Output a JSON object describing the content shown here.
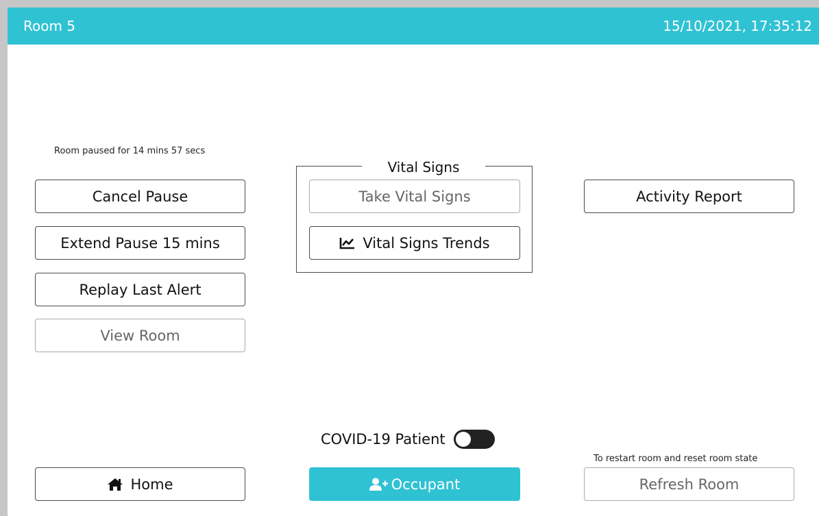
{
  "header": {
    "room_name": "Room 5",
    "datetime": "15/10/2021, 17:35:12",
    "background_color": "#2fc2d3"
  },
  "pause": {
    "status_text": "Room paused for 14 mins 57 secs",
    "cancel_label": "Cancel Pause",
    "extend_label": "Extend Pause 15 mins",
    "replay_label": "Replay Last Alert",
    "view_room_label": "View Room"
  },
  "vital_signs": {
    "legend": "Vital Signs",
    "take_label": "Take Vital Signs",
    "trends_label": "Vital Signs Trends",
    "trends_icon": "chart-line-icon"
  },
  "activity": {
    "report_label": "Activity Report"
  },
  "covid": {
    "label": "COVID-19 Patient",
    "enabled": false
  },
  "footer": {
    "home_label": "Home",
    "home_icon": "home-icon",
    "occupant_label": "Occupant",
    "occupant_icon": "user-plus-icon",
    "refresh_hint": "To restart room and reset room state",
    "refresh_label": "Refresh Room"
  }
}
